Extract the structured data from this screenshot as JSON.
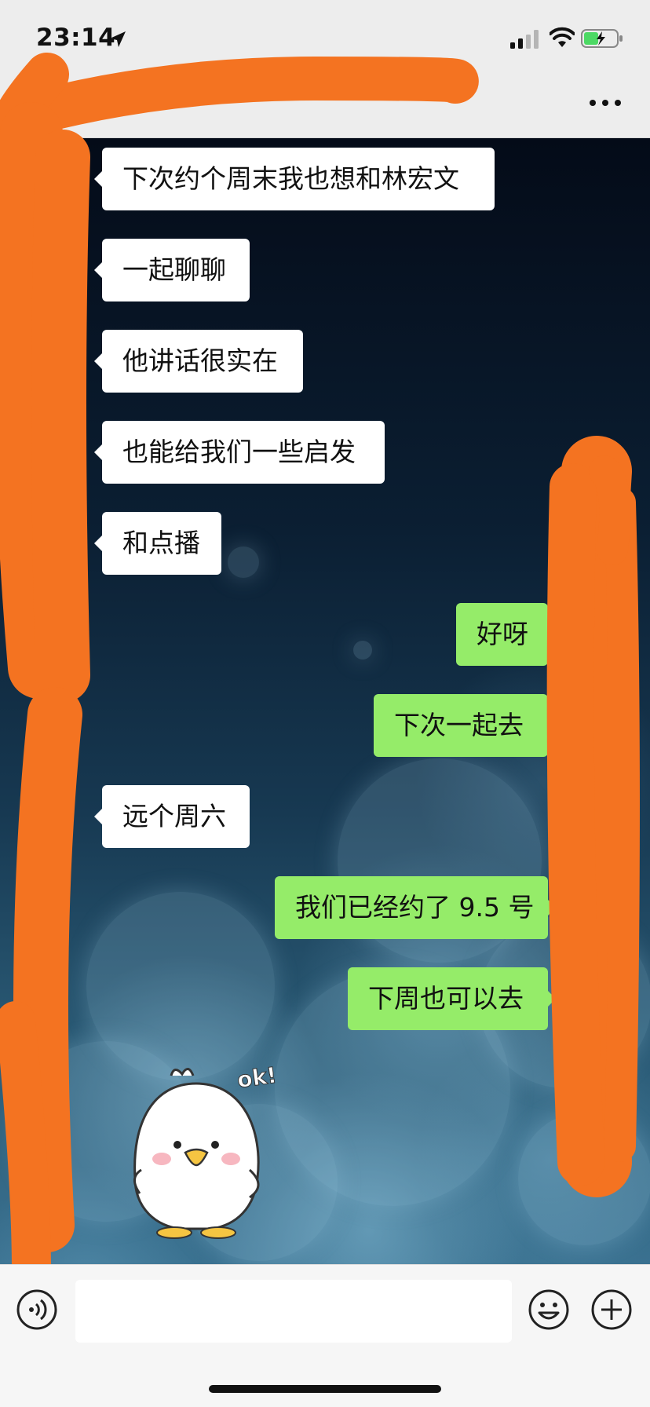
{
  "status_bar": {
    "time": "23:14",
    "icons": [
      "location-arrow-icon",
      "signal-icon",
      "wifi-icon",
      "battery-charging-icon"
    ]
  },
  "nav_bar": {
    "menu_icon": "more-icon"
  },
  "chat": {
    "messages": [
      {
        "side": "incoming",
        "text": "下次约个周末我也想和林宏文"
      },
      {
        "side": "incoming",
        "text": "一起聊聊"
      },
      {
        "side": "incoming",
        "text": "他讲话很实在"
      },
      {
        "side": "incoming",
        "text": "也能给我们一些启发"
      },
      {
        "side": "incoming",
        "text": "和点播"
      },
      {
        "side": "outgoing",
        "text": "好呀"
      },
      {
        "side": "outgoing",
        "text": "下次一起去"
      },
      {
        "side": "incoming",
        "text": "远个周六"
      },
      {
        "side": "outgoing",
        "text": "我们已经约了 9.5 号"
      },
      {
        "side": "outgoing",
        "text": "下周也可以去"
      }
    ],
    "sticker": {
      "caption": "ok!",
      "icon": "duck-sticker-icon"
    }
  },
  "input_bar": {
    "placeholder": "",
    "icons": [
      "voice-icon",
      "emoji-icon",
      "plus-icon"
    ]
  },
  "colors": {
    "incoming_bubble": "#ffffff",
    "outgoing_bubble": "#95ec69",
    "redaction": "#f47321",
    "bar_background": "#ededed"
  }
}
